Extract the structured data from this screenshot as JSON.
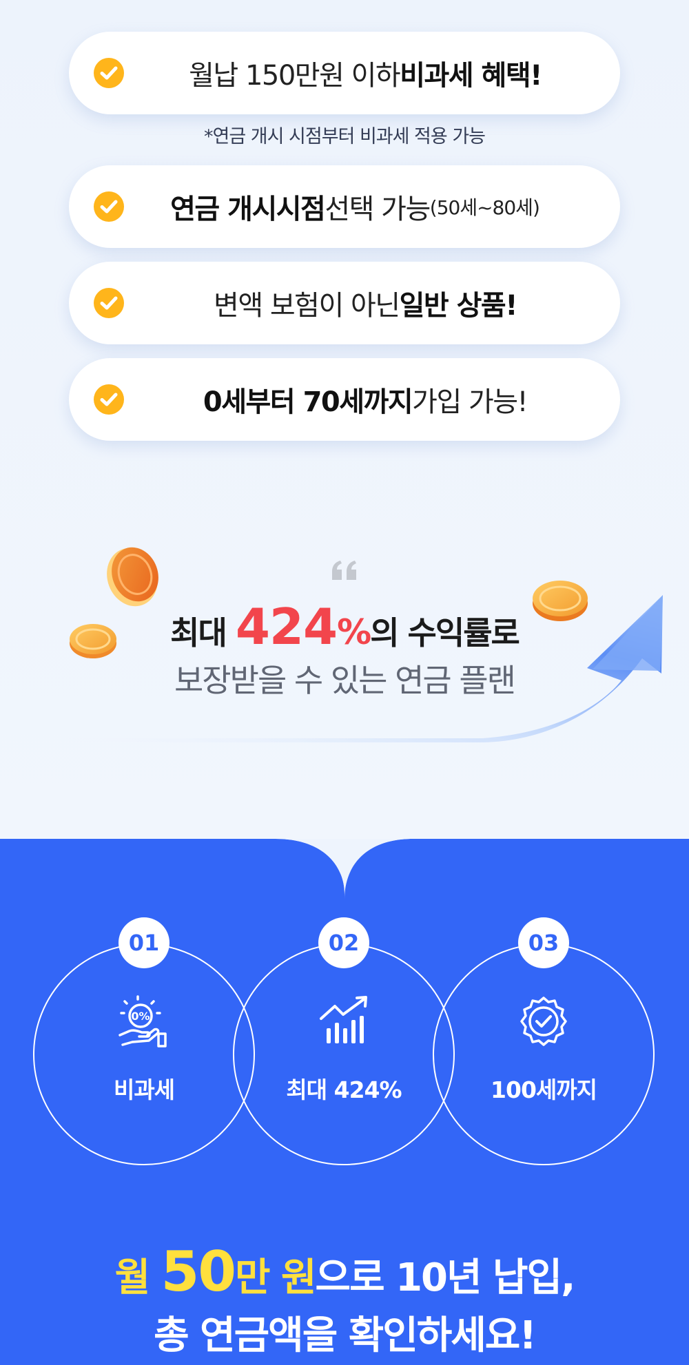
{
  "benefits": [
    {
      "pre": "월납 150만원 이하 ",
      "bold": "비과세 혜택!",
      "post": "",
      "small": ""
    },
    {
      "pre": "",
      "bold": "연금 개시시점",
      "post": " 선택 가능",
      "small": "(50세~80세)"
    },
    {
      "pre": "변액 보험이 아닌 ",
      "bold": "일반 상품!",
      "post": "",
      "small": ""
    },
    {
      "pre": "",
      "bold": "0세부터 70세까지",
      "post": " 가입 가능!",
      "small": ""
    }
  ],
  "note": "*연금 개시 시점부터 비과세 적용 가능",
  "highlight": {
    "prefix": "최대 ",
    "number": "424",
    "percent": "%",
    "suffix": "의 수익률로",
    "line2": "보장받을 수 있는 연금 플랜"
  },
  "features": [
    {
      "num": "01",
      "label": "비과세",
      "icon": "zero-percent-hand-icon"
    },
    {
      "num": "02",
      "label": "최대 424%",
      "icon": "growth-chart-icon"
    },
    {
      "num": "03",
      "label": "100세까지",
      "icon": "certified-badge-icon"
    }
  ],
  "cta": {
    "line1_a": "월 ",
    "line1_b": "50",
    "line1_c": "만 원",
    "line1_d": "으로 10년 납입,",
    "line2": "총 연금액을 확인하세요!"
  },
  "colors": {
    "accent_blue": "#3366f7",
    "check_yellow": "#ffb51b",
    "highlight_red": "#f2454c",
    "cta_yellow": "#ffe03d"
  }
}
